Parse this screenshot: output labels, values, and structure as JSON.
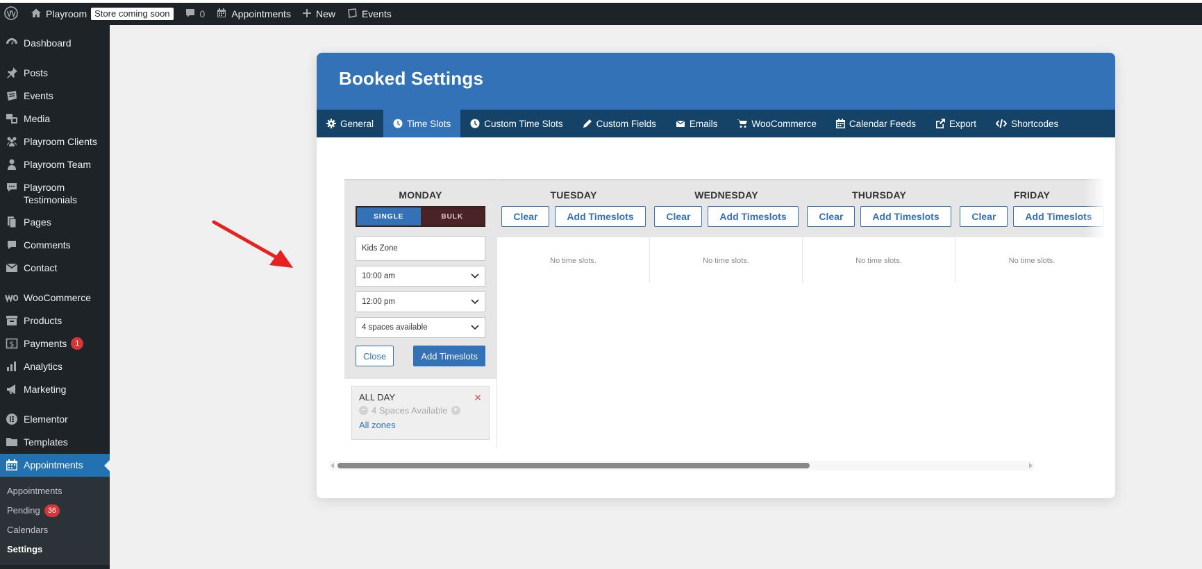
{
  "adminbar": {
    "site_name": "Playroom",
    "store_badge": "Store coming soon",
    "comments_count": "0",
    "appointments": "Appointments",
    "new": "New",
    "events": "Events",
    "icons": [
      "wordpress-logo-icon",
      "home-icon",
      "comment-icon",
      "calendar-icon",
      "plus-icon",
      "events-icon"
    ]
  },
  "sidebar": {
    "items": [
      {
        "label": "Dashboard",
        "icon": "dashboard-icon"
      },
      {
        "label": "Posts",
        "icon": "pin-icon"
      },
      {
        "label": "Events",
        "icon": "events-icon"
      },
      {
        "label": "Media",
        "icon": "media-icon"
      },
      {
        "label": "Playroom Clients",
        "icon": "groups-icon"
      },
      {
        "label": "Playroom Team",
        "icon": "person-icon"
      },
      {
        "label": "Playroom Testimonials",
        "icon": "chat-icon"
      },
      {
        "label": "Pages",
        "icon": "pages-icon"
      },
      {
        "label": "Comments",
        "icon": "comment-icon"
      },
      {
        "label": "Contact",
        "icon": "mail-icon"
      },
      {
        "label": "WooCommerce",
        "icon": "woo-icon"
      },
      {
        "label": "Products",
        "icon": "archive-icon"
      },
      {
        "label": "Payments",
        "icon": "dollar-icon",
        "badge": "1"
      },
      {
        "label": "Analytics",
        "icon": "bar-chart-icon"
      },
      {
        "label": "Marketing",
        "icon": "megaphone-icon"
      },
      {
        "label": "Elementor",
        "icon": "elementor-icon"
      },
      {
        "label": "Templates",
        "icon": "folder-icon"
      },
      {
        "label": "Appointments",
        "icon": "calendar-icon"
      }
    ],
    "submenu": [
      {
        "label": "Appointments"
      },
      {
        "label": "Pending",
        "badge": "36"
      },
      {
        "label": "Calendars"
      },
      {
        "label": "Settings"
      }
    ]
  },
  "panel": {
    "title": "Booked Settings",
    "tabs": [
      {
        "label": "General",
        "icon": "gear-icon"
      },
      {
        "label": "Time Slots",
        "icon": "clock-icon"
      },
      {
        "label": "Custom Time Slots",
        "icon": "clock-icon"
      },
      {
        "label": "Custom Fields",
        "icon": "pencil-icon"
      },
      {
        "label": "Emails",
        "icon": "envelope-icon"
      },
      {
        "label": "WooCommerce",
        "icon": "cart-icon"
      },
      {
        "label": "Calendar Feeds",
        "icon": "calendar-icon"
      },
      {
        "label": "Export",
        "icon": "external-link-icon"
      },
      {
        "label": "Shortcodes",
        "icon": "code-icon"
      }
    ],
    "active_tab": "Time Slots"
  },
  "calendar": {
    "monday": {
      "name": "MONDAY",
      "toggle_single": "SINGLE",
      "toggle_bulk": "BULK",
      "title_value": "Kids Zone",
      "start_time": "10:00 am",
      "end_time": "12:00 pm",
      "spaces": "4 spaces available",
      "close": "Close",
      "add": "Add Timeslots",
      "slot": {
        "title": "ALL DAY",
        "spaces": "4 Spaces Available",
        "zone": "All zones"
      }
    },
    "days": [
      {
        "name": "TUESDAY",
        "clear": "Clear",
        "add": "Add Timeslots",
        "empty": "No time slots."
      },
      {
        "name": "WEDNESDAY",
        "clear": "Clear",
        "add": "Add Timeslots",
        "empty": "No time slots."
      },
      {
        "name": "THURSDAY",
        "clear": "Clear",
        "add": "Add Timeslots",
        "empty": "No time slots."
      },
      {
        "name": "FRIDAY",
        "clear": "Clear",
        "add": "Add Timeslots",
        "empty": "No time slots."
      }
    ]
  },
  "colors": {
    "admin_dark": "#1d2327",
    "accent_blue": "#3372b6",
    "tabs_navy": "#154368",
    "annotation_red": "#e8201f"
  }
}
